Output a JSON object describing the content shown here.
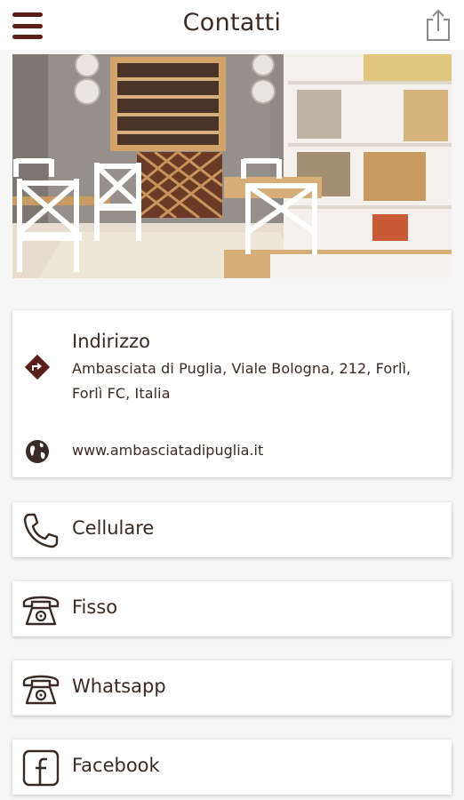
{
  "header": {
    "title": "Contatti"
  },
  "hero": {
    "icon": "restaurant-photo"
  },
  "address": {
    "title": "Indirizzo",
    "line1": "Ambasciata di Puglia, Viale Bologna, 212, Forlì,",
    "line2": "Forlì FC, Italia",
    "website": "www.ambasciatadipuglia.it"
  },
  "contacts": [
    {
      "label": "Cellulare",
      "icon": "phone-handset-icon"
    },
    {
      "label": "Fisso",
      "icon": "desk-phone-icon"
    },
    {
      "label": "Whatsapp",
      "icon": "desk-phone-icon"
    },
    {
      "label": "Facebook",
      "icon": "facebook-icon"
    }
  ],
  "colors": {
    "accent": "#5b1f1a",
    "text": "#3a2a24",
    "background": "#f6f6f6"
  }
}
